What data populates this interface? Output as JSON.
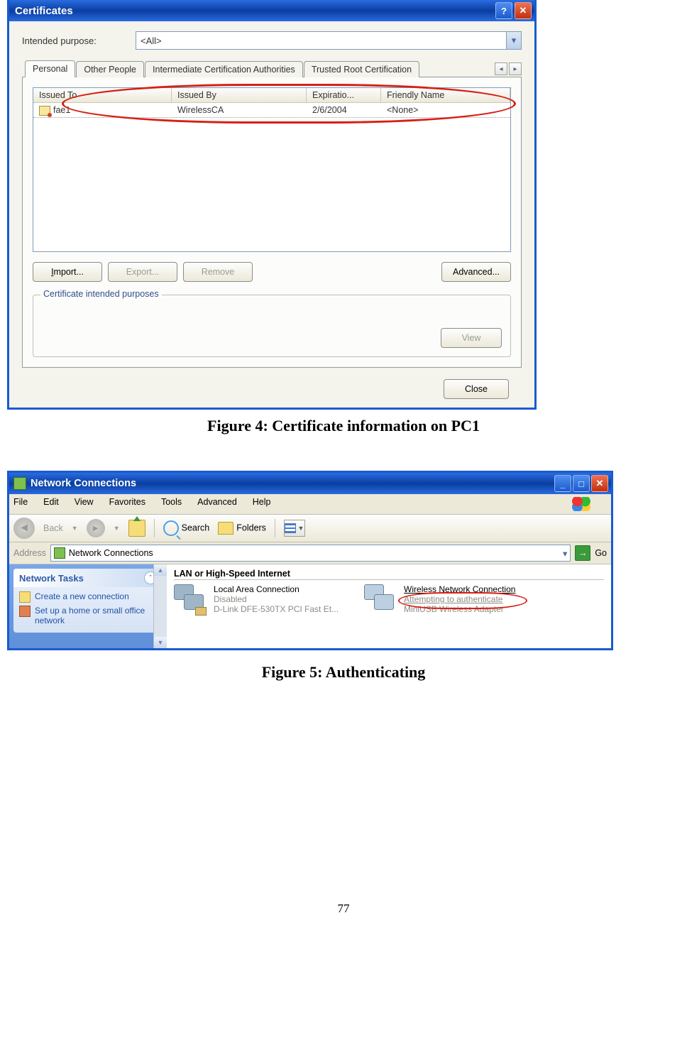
{
  "cert": {
    "title": "Certificates",
    "purpose_label": "Intended purpose:",
    "purpose_value": "<All>",
    "tabs": {
      "t0": "Personal",
      "t1": "Other People",
      "t2": "Intermediate Certification Authorities",
      "t3": "Trusted Root Certification"
    },
    "columns": {
      "a": "Issued To",
      "b": "Issued By",
      "c": "Expiratio...",
      "d": "Friendly Name"
    },
    "rows": [
      {
        "a": "fae1",
        "b": "WirelessCA",
        "c": "2/6/2004",
        "d": "<None>"
      }
    ],
    "buttons": {
      "importb": "Import...",
      "exportb": "Export...",
      "removeb": "Remove",
      "advancedb": "Advanced...",
      "viewb": "View",
      "closeb": "Close"
    },
    "group_label": "Certificate intended purposes"
  },
  "figure4": "Figure 4: Certificate information on PC1",
  "net": {
    "title": "Network Connections",
    "menu": {
      "file": "File",
      "edit": "Edit",
      "view": "View",
      "fav": "Favorites",
      "tools": "Tools",
      "adv": "Advanced",
      "help": "Help"
    },
    "toolbar": {
      "back": "Back",
      "search": "Search",
      "folders": "Folders"
    },
    "address_label": "Address",
    "address_value": "Network Connections",
    "go": "Go",
    "task_header": "Network Tasks",
    "task1": "Create a new connection",
    "task2": "Set up a home or small office network",
    "group_header": "LAN or High-Speed Internet",
    "item1": {
      "title": "Local Area Connection",
      "sub1": "Disabled",
      "sub2": "D-Link DFE-530TX PCI Fast Et..."
    },
    "item2": {
      "title": "Wireless Network Connection",
      "sub1": "Attempting to authenticate",
      "sub2": "MiniUSB Wireless Adapter"
    }
  },
  "figure5": "Figure 5: Authenticating",
  "pagenum": "77"
}
